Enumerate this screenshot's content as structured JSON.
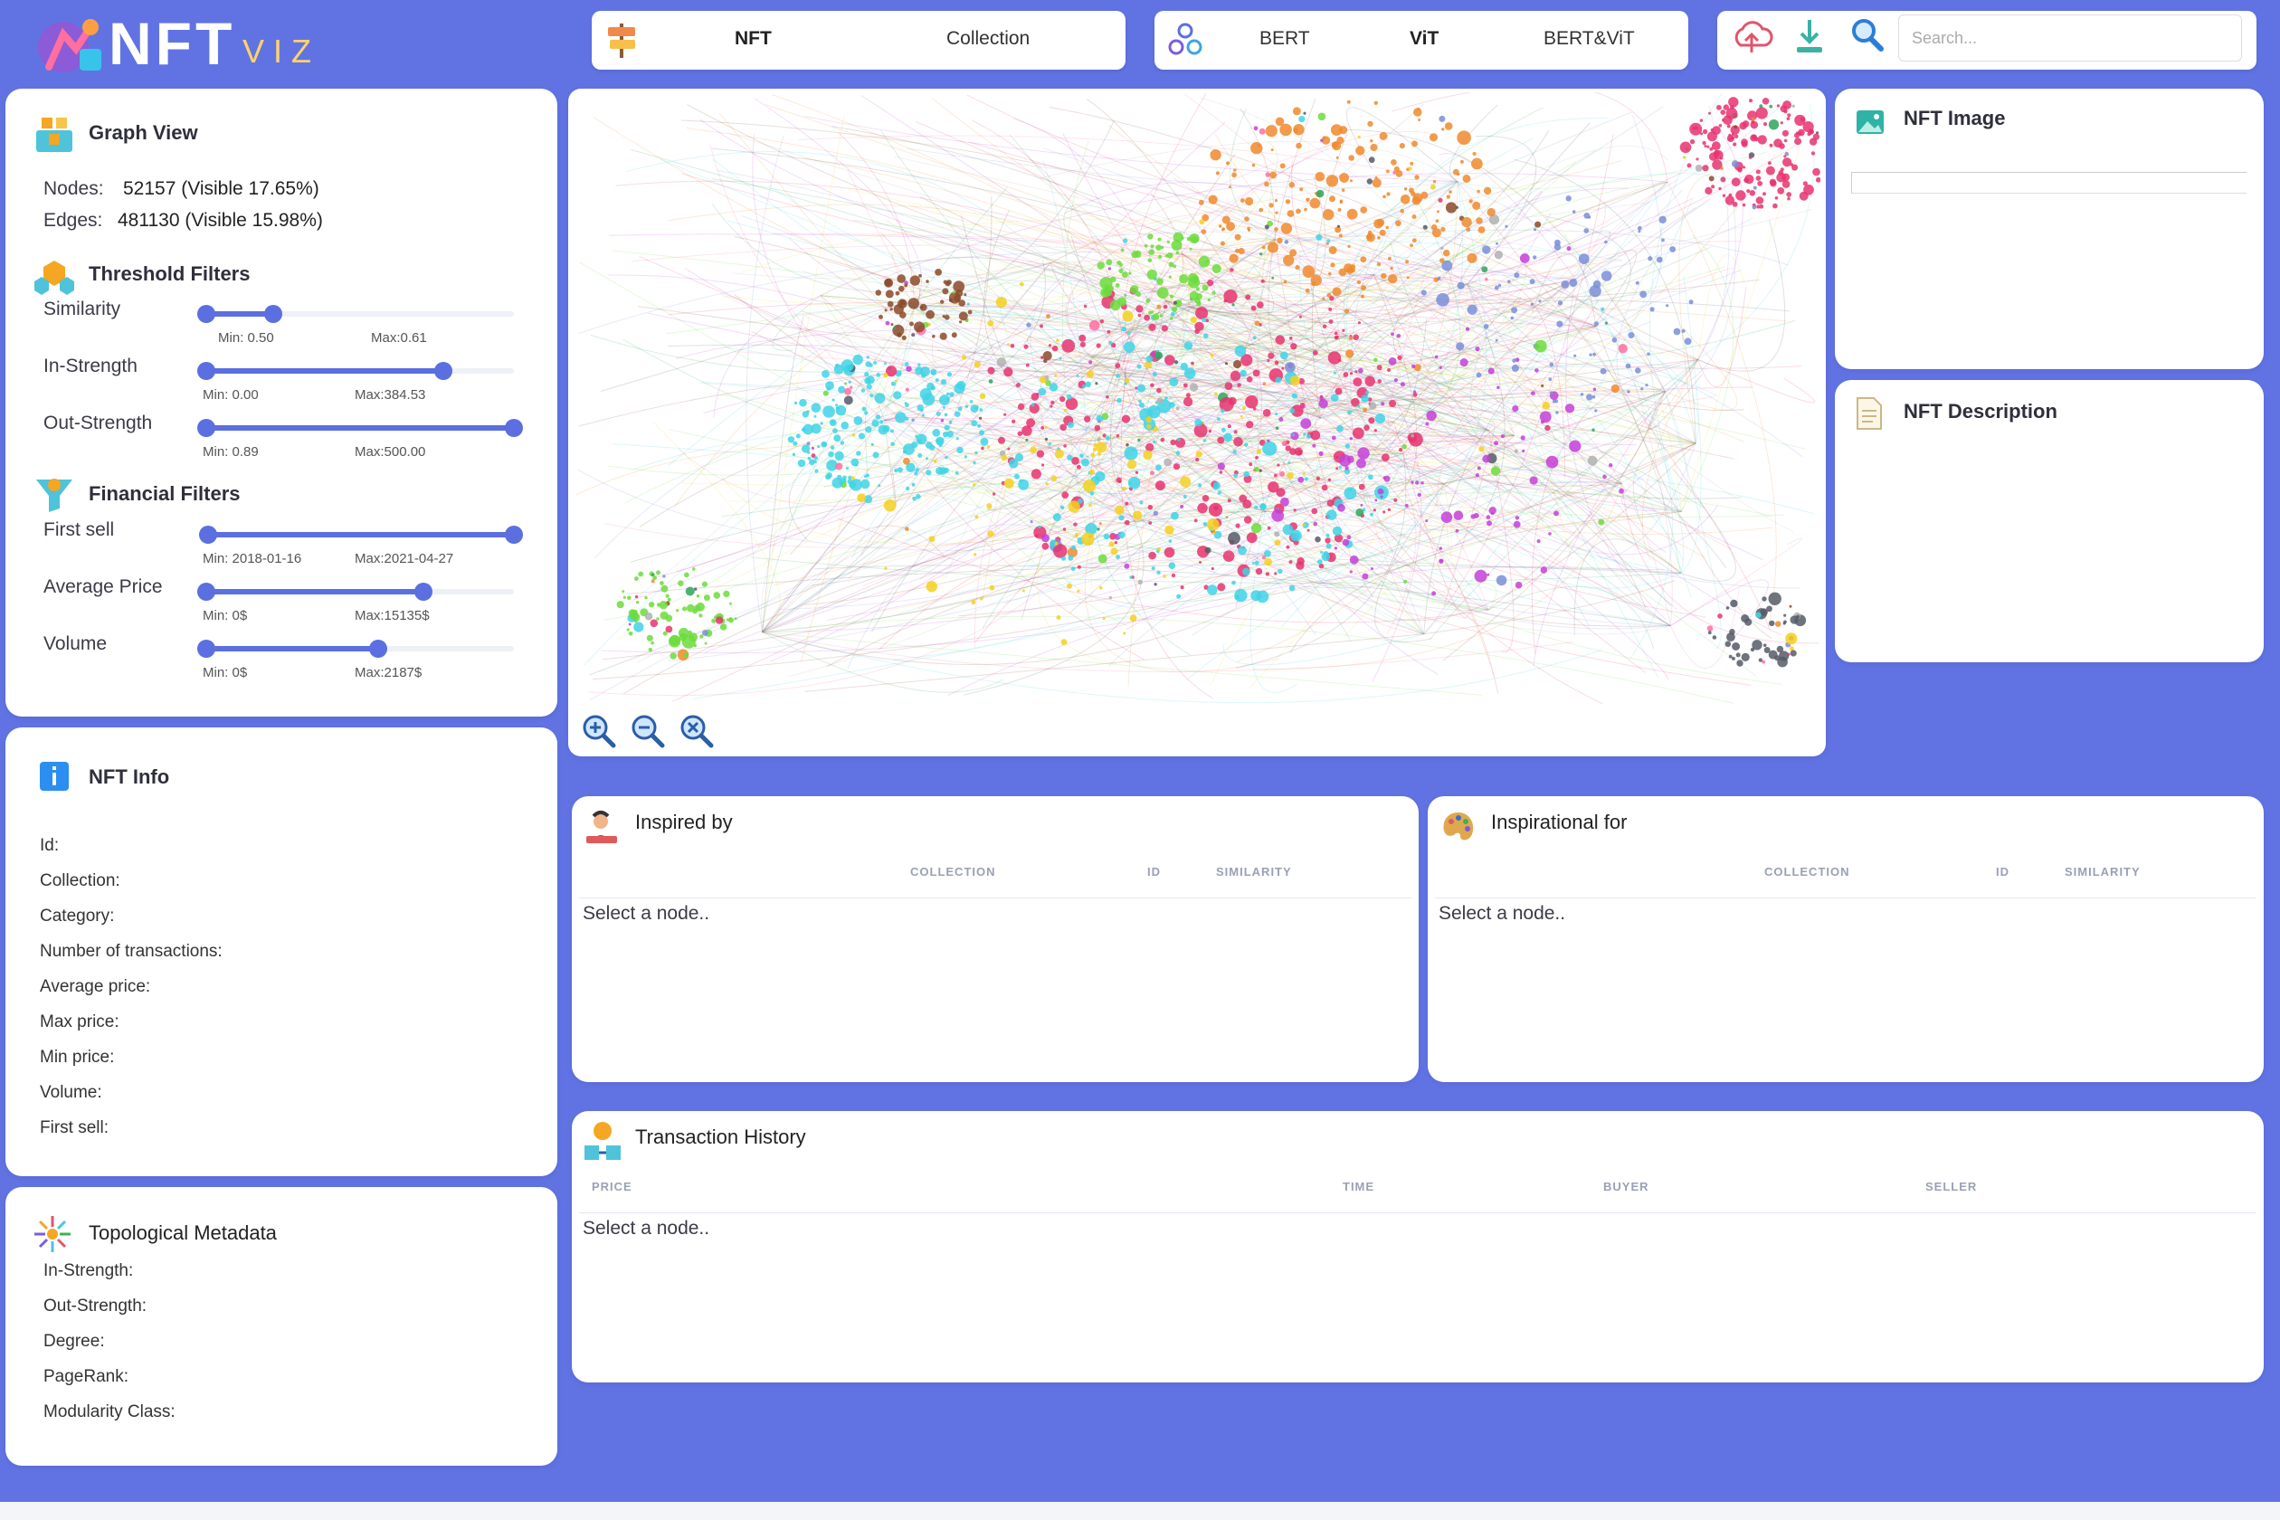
{
  "app": {
    "logo_main": "NFT",
    "logo_sub": "VIZ"
  },
  "header": {
    "view_tabs": [
      "NFT",
      "Collection"
    ],
    "active_view": "NFT",
    "model_tabs": [
      "BERT",
      "ViT",
      "BERT&ViT"
    ],
    "active_model": "ViT",
    "search_placeholder": "Search..."
  },
  "graph_view": {
    "title": "Graph View",
    "nodes_label": "Nodes:",
    "nodes_value": "52157 (Visible 17.65%)",
    "edges_label": "Edges:",
    "edges_value": "481130 (Visible 15.98%)"
  },
  "threshold_filters": {
    "title": "Threshold Filters",
    "similarity": {
      "label": "Similarity",
      "min": "Min: 0.50",
      "max": "Max:0.61",
      "range": [
        0.0,
        0.22
      ]
    },
    "in_strength": {
      "label": "In-Strength",
      "min": "Min: 0.00",
      "max": "Max:384.53",
      "range": [
        0.0,
        0.77
      ]
    },
    "out_strength": {
      "label": "Out-Strength",
      "min": "Min: 0.89",
      "max": "Max:500.00",
      "range": [
        0.0,
        1.0
      ]
    }
  },
  "financial_filters": {
    "title": "Financial Filters",
    "first_sell": {
      "label": "First sell",
      "min": "Min: 2018-01-16",
      "max": "Max:2021-04-27",
      "range": [
        0.0,
        1.0
      ]
    },
    "average_price": {
      "label": "Average Price",
      "min": "Min: 0$",
      "max": "Max:15135$",
      "range": [
        0.0,
        0.71
      ]
    },
    "volume": {
      "label": "Volume",
      "min": "Min: 0$",
      "max": "Max:2187$",
      "range": [
        0.0,
        0.56
      ]
    }
  },
  "nft_info": {
    "title": "NFT Info",
    "fields": [
      "Id:",
      "Collection:",
      "Category:",
      "Number of transactions:",
      "Average price:",
      "Max price:",
      "Min price:",
      "Volume:",
      "First sell:"
    ]
  },
  "topological": {
    "title": "Topological Metadata",
    "fields": [
      "In-Strength:",
      "Out-Strength:",
      "Degree:",
      "PageRank:",
      "Modularity Class:"
    ]
  },
  "nft_image": {
    "title": "NFT Image"
  },
  "nft_description": {
    "title": "NFT Description"
  },
  "inspired_by": {
    "title": "Inspired by",
    "columns": [
      "COLLECTION",
      "ID",
      "SIMILARITY"
    ],
    "empty": "Select a node.."
  },
  "inspirational_for": {
    "title": "Inspirational for",
    "columns": [
      "COLLECTION",
      "ID",
      "SIMILARITY"
    ],
    "empty": "Select a node.."
  },
  "transaction_history": {
    "title": "Transaction History",
    "columns": [
      "PRICE",
      "TIME",
      "BUYER",
      "SELLER"
    ],
    "empty": "Select a node.."
  },
  "colors": {
    "accent": "#5b6fe0",
    "background": "#6173e3"
  }
}
